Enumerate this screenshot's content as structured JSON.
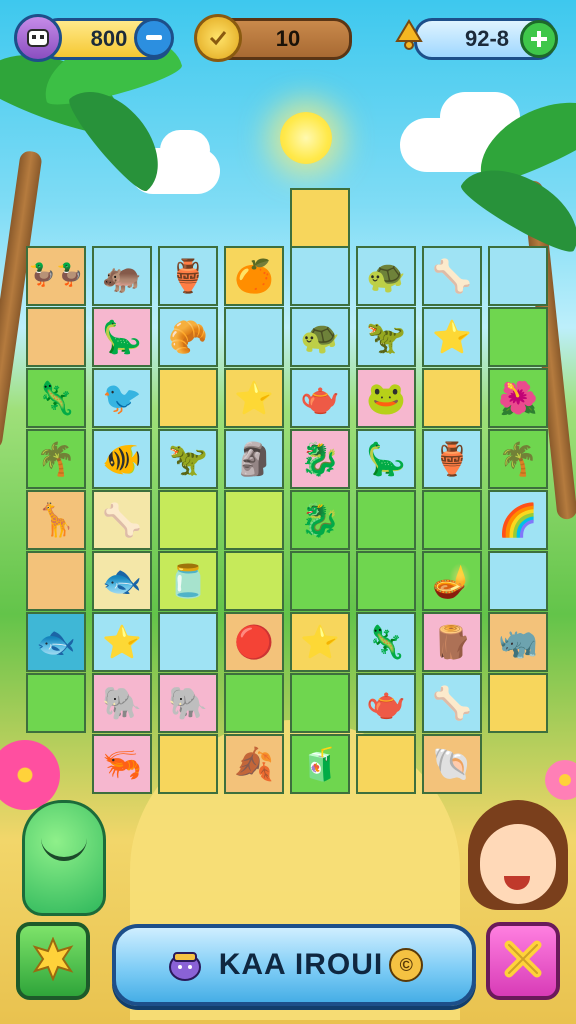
{
  "hud": {
    "coins": "800",
    "level": "10",
    "stars": "92-8",
    "avatar_icon": "robot-face-icon",
    "coin_icon": "gold-check-coin-icon",
    "bell_icon": "bell-icon"
  },
  "board": {
    "rows": [
      [
        {
          "bg": "orange",
          "icon": "🦆🦆",
          "name": "twin-chicks"
        },
        {
          "bg": "cyan",
          "icon": "🦛",
          "name": "purple-hippo"
        },
        {
          "bg": "cyan",
          "icon": "🏺",
          "name": "grey-pot"
        },
        {
          "bg": "yellow",
          "icon": "🍊",
          "name": "orange-fruit"
        },
        {
          "bg": "cyan",
          "icon": "",
          "name": "empty"
        },
        {
          "bg": "cyan",
          "icon": "🐢",
          "name": "green-turtle"
        },
        {
          "bg": "cyan",
          "icon": "🦴",
          "name": "bone"
        },
        {
          "bg": "cyan",
          "icon": "",
          "name": "empty"
        }
      ],
      [
        {
          "bg": "orange",
          "icon": "",
          "name": "empty"
        },
        {
          "bg": "pink",
          "icon": "🦕",
          "name": "blue-dino"
        },
        {
          "bg": "cyan",
          "icon": "🥐",
          "name": "bun"
        },
        {
          "bg": "cyan",
          "icon": "",
          "name": "empty"
        },
        {
          "bg": "cyan",
          "icon": "🐢",
          "name": "green-turtle"
        },
        {
          "bg": "cyan",
          "icon": "🦖",
          "name": "green-dino"
        },
        {
          "bg": "cyan",
          "icon": "⭐",
          "name": "star"
        },
        {
          "bg": "green",
          "icon": "",
          "name": "empty"
        }
      ],
      [
        {
          "bg": "green",
          "icon": "🦎",
          "name": "blue-lizard"
        },
        {
          "bg": "cyan",
          "icon": "🐦",
          "name": "blue-bird"
        },
        {
          "bg": "yellow",
          "icon": "",
          "name": "empty"
        },
        {
          "bg": "yellow",
          "icon": "⭐",
          "name": "star"
        },
        {
          "bg": "cyan",
          "icon": "🫖",
          "name": "blue-pot"
        },
        {
          "bg": "pink",
          "icon": "🐸",
          "name": "purple-frog"
        },
        {
          "bg": "yellow",
          "icon": "",
          "name": "empty"
        },
        {
          "bg": "green",
          "icon": "🌺",
          "name": "hibiscus"
        }
      ],
      [
        {
          "bg": "green",
          "icon": "🌴",
          "name": "palm"
        },
        {
          "bg": "cyan",
          "icon": "🐠",
          "name": "orange-fish"
        },
        {
          "bg": "cyan",
          "icon": "🦖",
          "name": "orange-dino"
        },
        {
          "bg": "cyan",
          "icon": "🗿",
          "name": "green-totem"
        },
        {
          "bg": "pink",
          "icon": "🐉",
          "name": "pink-dragon"
        },
        {
          "bg": "cyan",
          "icon": "🦕",
          "name": "yellow-dino"
        },
        {
          "bg": "cyan",
          "icon": "🏺",
          "name": "blue-jar"
        },
        {
          "bg": "green",
          "icon": "🌴",
          "name": "palm"
        }
      ],
      [
        {
          "bg": "orange",
          "icon": "🦒",
          "name": "giraffe"
        },
        {
          "bg": "sand",
          "icon": "🦴",
          "name": "boomerang"
        },
        {
          "bg": "lime",
          "icon": "",
          "name": "empty"
        },
        {
          "bg": "lime",
          "icon": "",
          "name": "empty"
        },
        {
          "bg": "green",
          "icon": "🐉",
          "name": "purple-dragon"
        },
        {
          "bg": "green",
          "icon": "",
          "name": "empty"
        },
        {
          "bg": "green",
          "icon": "",
          "name": "empty"
        },
        {
          "bg": "cyan",
          "icon": "🌈",
          "name": "rainbow"
        }
      ],
      [
        {
          "bg": "orange",
          "icon": "",
          "name": "empty"
        },
        {
          "bg": "sand",
          "icon": "🐟",
          "name": "red-fish"
        },
        {
          "bg": "lime",
          "icon": "🫙",
          "name": "white-jar"
        },
        {
          "bg": "lime",
          "icon": "",
          "name": "empty"
        },
        {
          "bg": "green",
          "icon": "",
          "name": "empty"
        },
        {
          "bg": "green",
          "icon": "",
          "name": "empty"
        },
        {
          "bg": "green",
          "icon": "🪔",
          "name": "orange-lamp"
        },
        {
          "bg": "cyan",
          "icon": "",
          "name": "empty"
        }
      ],
      [
        {
          "bg": "teal",
          "icon": "🐟",
          "name": "green-fish"
        },
        {
          "bg": "cyan",
          "icon": "⭐",
          "name": "star"
        },
        {
          "bg": "cyan",
          "icon": "",
          "name": "empty"
        },
        {
          "bg": "orange",
          "icon": "🔴",
          "name": "red-ball"
        },
        {
          "bg": "yellow",
          "icon": "⭐",
          "name": "star"
        },
        {
          "bg": "cyan",
          "icon": "🦎",
          "name": "green-lizard"
        },
        {
          "bg": "pink",
          "icon": "🪵",
          "name": "log"
        },
        {
          "bg": "orange",
          "icon": "🦏",
          "name": "rhino"
        }
      ],
      [
        {
          "bg": "green",
          "icon": "",
          "name": "empty"
        },
        {
          "bg": "pink",
          "icon": "🐘",
          "name": "purple-elephant"
        },
        {
          "bg": "pink",
          "icon": "🐘",
          "name": "purple-elephant"
        },
        {
          "bg": "green",
          "icon": "",
          "name": "empty"
        },
        {
          "bg": "green",
          "icon": "",
          "name": "empty"
        },
        {
          "bg": "cyan",
          "icon": "🫖",
          "name": "blue-kettle"
        },
        {
          "bg": "cyan",
          "icon": "🦴",
          "name": "bone"
        },
        {
          "bg": "yellow",
          "icon": "",
          "name": "empty"
        }
      ],
      [
        {
          "bg": "none",
          "icon": "",
          "name": "none"
        },
        {
          "bg": "pink",
          "icon": "🦐",
          "name": "red-shrimp"
        },
        {
          "bg": "yellow",
          "icon": "",
          "name": "empty"
        },
        {
          "bg": "orange",
          "icon": "🍂",
          "name": "leaf"
        },
        {
          "bg": "green",
          "icon": "🧃",
          "name": "green-can"
        },
        {
          "bg": "yellow",
          "icon": "",
          "name": "empty"
        },
        {
          "bg": "orange",
          "icon": "🐚",
          "name": "shell"
        },
        {
          "bg": "none",
          "icon": "",
          "name": "none"
        }
      ]
    ],
    "extra_top_block": "yellow"
  },
  "bottom": {
    "left_button_icon": "sun-burst-icon",
    "main_button_label": "KAA IROUI",
    "main_button_suffix": "©",
    "main_button_icon": "purple-creature-icon",
    "close_button_icon": "close-x-icon"
  }
}
